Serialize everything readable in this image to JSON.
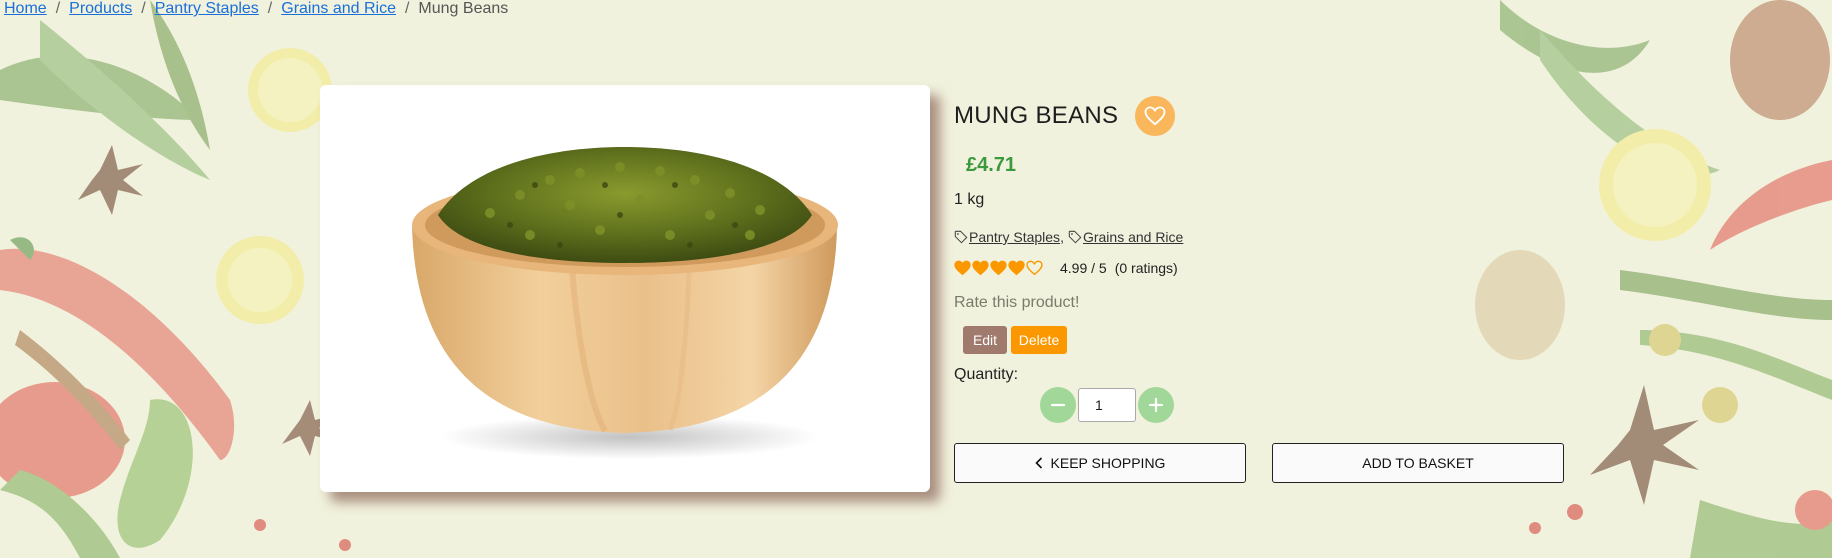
{
  "breadcrumb": {
    "home": "Home",
    "products": "Products",
    "category": "Pantry Staples",
    "subcategory": "Grains and Rice",
    "current": "Mung Beans",
    "separator": "/"
  },
  "product": {
    "name": "MUNG BEANS",
    "price": "£4.71",
    "size": "1 kg",
    "tags": [
      "Pantry Staples ",
      "Grains and Rice"
    ],
    "tag_separator": ",",
    "rating_value": "4.99 / 5",
    "rating_count": "(0 ratings)",
    "rate_prompt": "Rate this product!",
    "stars_filled": 4,
    "stars_total": 5,
    "image_icon": "mung-beans-bowl-photo"
  },
  "admin": {
    "edit_label": "Edit",
    "delete_label": "Delete"
  },
  "quantity": {
    "label": "Quantity:",
    "value": "1"
  },
  "actions": {
    "keep_shopping": "KEEP SHOPPING",
    "add_to_basket": "ADD TO BASKET"
  },
  "colors": {
    "accent_orange": "#fb9800",
    "favorite_bg": "#f9b65b",
    "price_green": "#3c9a3c",
    "qty_button_green": "#a2d79a",
    "edit_brown": "#a07a6c"
  }
}
